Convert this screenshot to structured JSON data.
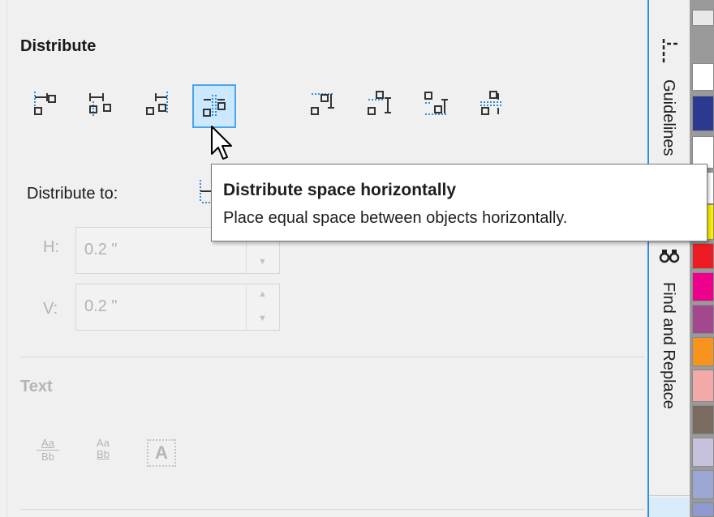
{
  "distribute": {
    "title": "Distribute",
    "buttons": [
      {
        "name": "distribute-left",
        "icon": "distribute-left-icon",
        "active": false
      },
      {
        "name": "distribute-center-horizontally",
        "icon": "distribute-center-h-icon",
        "active": false
      },
      {
        "name": "distribute-right",
        "icon": "distribute-right-icon",
        "active": false
      },
      {
        "name": "distribute-space-horizontally",
        "icon": "distribute-space-h-icon",
        "active": true
      },
      {
        "name": "distribute-top",
        "icon": "distribute-top-icon",
        "active": false
      },
      {
        "name": "distribute-center-vertically",
        "icon": "distribute-center-v-icon",
        "active": false
      },
      {
        "name": "distribute-bottom",
        "icon": "distribute-bottom-icon",
        "active": false
      },
      {
        "name": "distribute-space-vertically",
        "icon": "distribute-space-v-icon",
        "active": false
      }
    ],
    "distribute_to_label": "Distribute to:",
    "h_label": "H:",
    "h_value": "0.2 \"",
    "v_label": "V:",
    "v_value": "0.2 \""
  },
  "text_section": {
    "title": "Text",
    "icons": [
      "text-baseline-icon",
      "text-baseline-alt-icon",
      "text-bounding-box-icon"
    ],
    "icon_glyphs": {
      "aa": "Aa",
      "bb": "Bb",
      "a": "A"
    }
  },
  "tooltip": {
    "title": "Distribute space horizontally",
    "description": "Place equal space between objects horizontally."
  },
  "docker_tabs": [
    {
      "label": "Guidelines",
      "icon": "guidelines-icon"
    },
    {
      "label": "Find and Replace",
      "icon": "binoculars-icon"
    }
  ],
  "colors": {
    "accent": "#2c8ee8",
    "active_button_bg": "#cce8ff",
    "palette": [
      "#ffffff",
      "#2b3990",
      "#ffffff",
      "#fff200",
      "#ed1c24",
      "#ec008c",
      "#a3488e",
      "#f7941d",
      "#f4a9a9",
      "#7b6a5f",
      "#c7c1de",
      "#9da7d6"
    ]
  },
  "cursor": "arrow-pointer"
}
